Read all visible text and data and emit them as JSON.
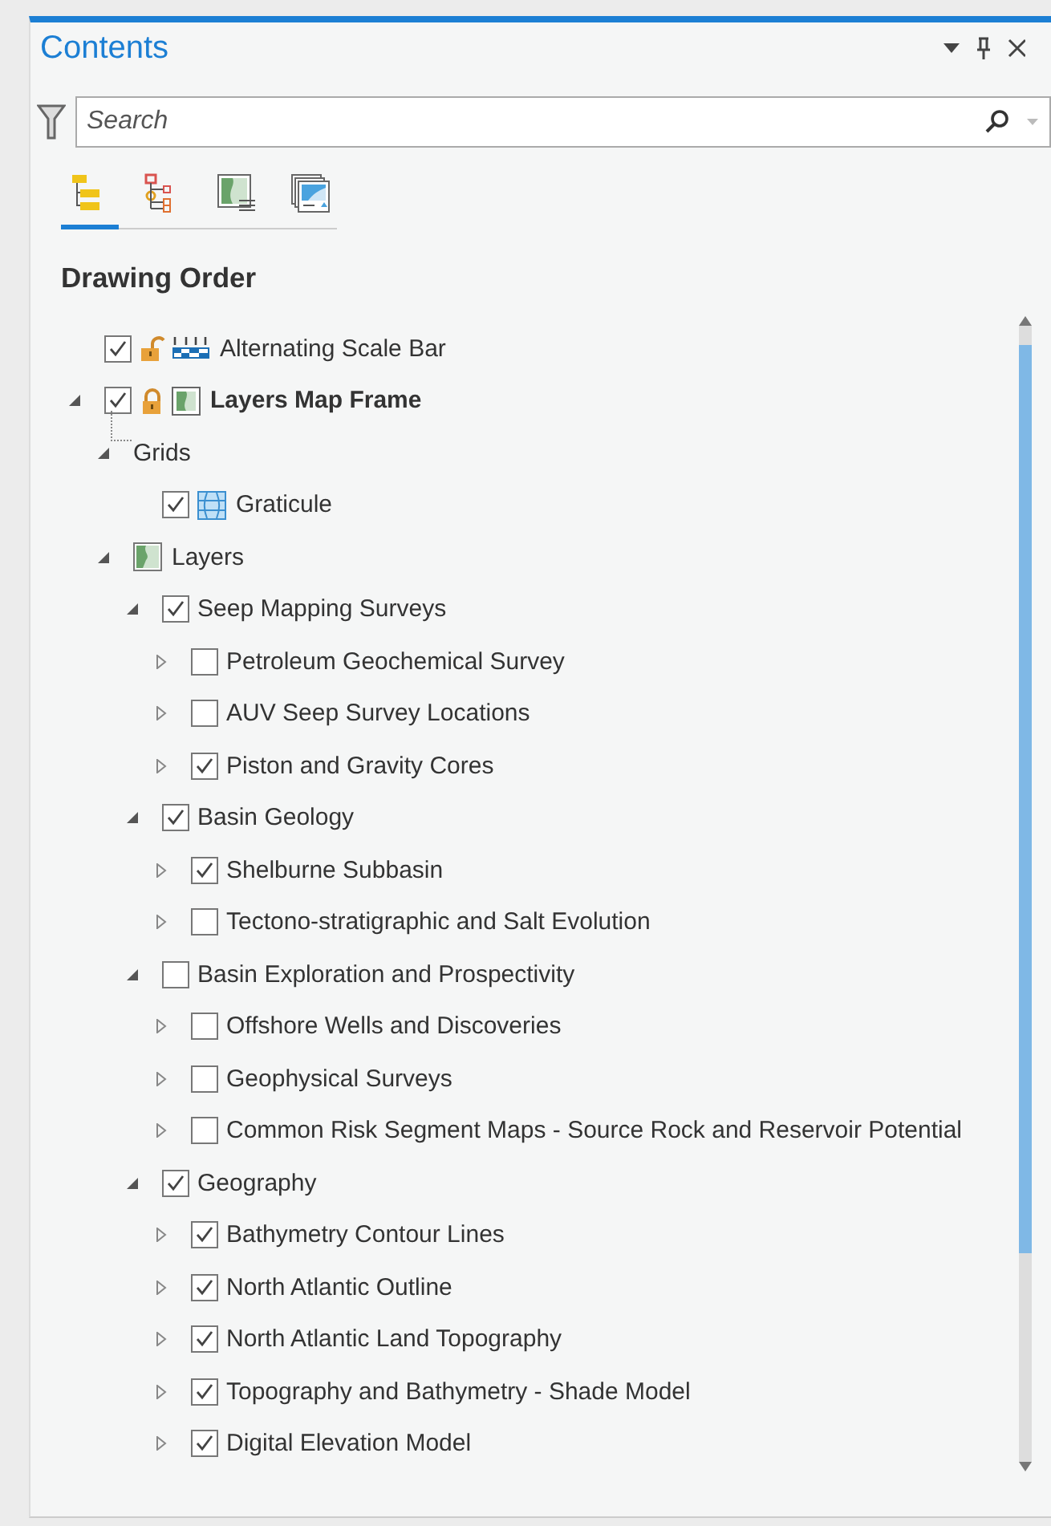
{
  "pane": {
    "title": "Contents"
  },
  "search": {
    "placeholder": "Search"
  },
  "views": [
    {
      "kind": "drawing-order",
      "selected": true
    },
    {
      "kind": "source",
      "selected": false
    },
    {
      "kind": "layout",
      "selected": false
    },
    {
      "kind": "pages",
      "selected": false
    }
  ],
  "section_title": "Drawing Order",
  "tree": [
    {
      "kind": "scale-bar",
      "label": "Alternating Scale Bar",
      "checked": true,
      "locked": false
    },
    {
      "kind": "map-frame",
      "label": "Layers Map Frame",
      "checked": true,
      "locked": true,
      "expanded": true,
      "children": [
        {
          "kind": "grids",
          "label": "Grids",
          "expanded": true,
          "children": [
            {
              "kind": "graticule",
              "label": "Graticule",
              "checked": true
            }
          ]
        },
        {
          "kind": "map",
          "label": "Layers",
          "expanded": true,
          "children": [
            {
              "label": "Seep Mapping Surveys",
              "checked": true,
              "expanded": true,
              "children": [
                {
                  "label": "Petroleum Geochemical Survey",
                  "checked": false,
                  "expanded": false
                },
                {
                  "label": "AUV Seep Survey Locations",
                  "checked": false,
                  "expanded": false
                },
                {
                  "label": "Piston and Gravity Cores",
                  "checked": true,
                  "expanded": false
                }
              ]
            },
            {
              "label": "Basin Geology",
              "checked": true,
              "expanded": true,
              "children": [
                {
                  "label": "Shelburne Subbasin",
                  "checked": true,
                  "expanded": false
                },
                {
                  "label": "Tectono-stratigraphic and Salt Evolution",
                  "checked": false,
                  "expanded": false
                }
              ]
            },
            {
              "label": "Basin Exploration and Prospectivity",
              "checked": false,
              "expanded": true,
              "children": [
                {
                  "label": "Offshore Wells and Discoveries",
                  "checked": false,
                  "expanded": false
                },
                {
                  "label": "Geophysical Surveys",
                  "checked": false,
                  "expanded": false
                },
                {
                  "label": "Common Risk Segment Maps - Source Rock and Reservoir Potential",
                  "checked": false,
                  "expanded": false
                }
              ]
            },
            {
              "label": "Geography",
              "checked": true,
              "expanded": true,
              "children": [
                {
                  "label": "Bathymetry Contour Lines",
                  "checked": true,
                  "expanded": false
                },
                {
                  "label": "North Atlantic Outline",
                  "checked": true,
                  "expanded": false
                },
                {
                  "label": "North Atlantic Land Topography",
                  "checked": true,
                  "expanded": false
                },
                {
                  "label": "Topography and Bathymetry - Shade Model",
                  "checked": true,
                  "expanded": false
                },
                {
                  "label": "Digital Elevation Model",
                  "checked": true,
                  "expanded": false
                }
              ]
            }
          ]
        }
      ]
    }
  ]
}
